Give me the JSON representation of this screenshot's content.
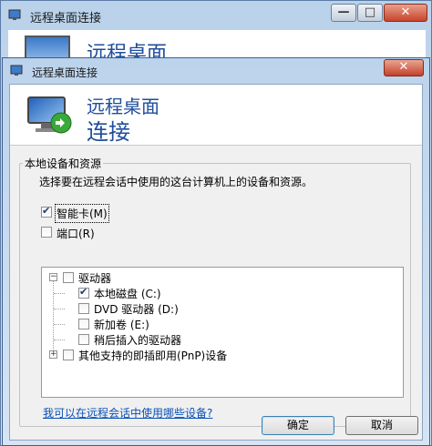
{
  "background_window": {
    "title": "远程桌面连接",
    "banner_title": "远程桌面"
  },
  "dialog": {
    "title": "远程桌面连接",
    "close_label": "✕",
    "banner": {
      "line1": "远程桌面",
      "line2": "连接"
    },
    "group_title": "本地设备和资源",
    "description": "选择要在远程会话中使用的这台计算机上的设备和资源。",
    "smartcard": {
      "label": "智能卡(M)",
      "checked": true
    },
    "ports": {
      "label": "端口(R)",
      "checked": false
    },
    "tree": {
      "drives": {
        "label": "驱动器",
        "checked": false,
        "expanded": true,
        "children": [
          {
            "label": "本地磁盘 (C:)",
            "checked": true
          },
          {
            "label": "DVD 驱动器 (D:)",
            "checked": false
          },
          {
            "label": "新加卷 (E:)",
            "checked": false
          },
          {
            "label": "稍后插入的驱动器",
            "checked": false
          }
        ]
      },
      "pnp": {
        "label": "其他支持的即插即用(PnP)设备",
        "checked": false,
        "expanded": false
      }
    },
    "help_link": "我可以在远程会话中使用哪些设备?",
    "ok_label": "确定",
    "cancel_label": "取消"
  },
  "colors": {
    "banner_text": "#1f4d9c",
    "link": "#0b52b8",
    "close_red": "#c5412a"
  }
}
